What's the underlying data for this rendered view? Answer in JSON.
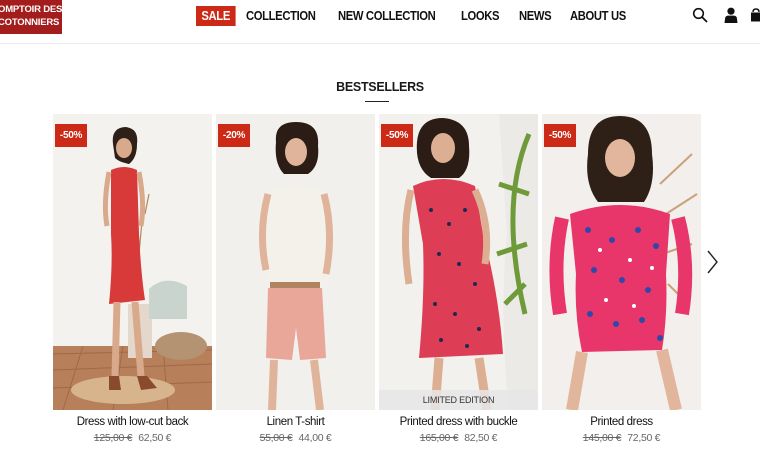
{
  "brand": {
    "line1": "OMPTOIR DES",
    "line2": "COTONNIERS"
  },
  "nav": {
    "sale": "SALE",
    "collection": "COLLECTION",
    "new_collection": "NEW COLLECTION",
    "looks": "LOOKS",
    "news": "NEWS",
    "about_us": "ABOUT US"
  },
  "header_icons": [
    "search-icon",
    "account-icon",
    "cart-icon"
  ],
  "section": {
    "title": "BESTSELLERS"
  },
  "products": [
    {
      "badge": "-50%",
      "name": "Dress with low-cut back",
      "old_price": "125,00 €",
      "price": "62,50 €"
    },
    {
      "badge": "-20%",
      "name": "Linen T-shirt",
      "old_price": "55,00 €",
      "price": "44,00 €"
    },
    {
      "badge": "-50%",
      "name": "Printed dress with buckle",
      "old_price": "165,00 €",
      "price": "82,50 €",
      "tag": "LIMITED EDITION"
    },
    {
      "badge": "-50%",
      "name": "Printed dress",
      "old_price": "145,00 €",
      "price": "72,50 €"
    }
  ],
  "colors": {
    "brand": "#a31d1d",
    "sale": "#cc2a16",
    "badge": "#cc2a16"
  }
}
